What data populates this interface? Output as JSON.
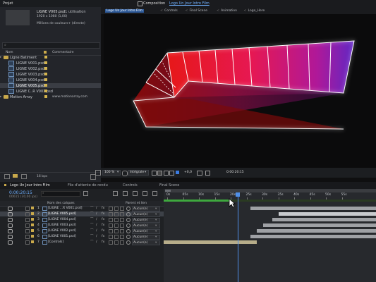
{
  "project": {
    "tab": "Projet",
    "file_name": "LIGNE V005.psd",
    "usage": ", 1 utilisation",
    "dimensions": "1920 x 1080 (1,00)",
    "colors": "Millions de couleurs+ (directe)",
    "col_name": "Nom",
    "col_comment": "Commentaire",
    "items": [
      {
        "label": "Ligne Batiment",
        "kind": "folder",
        "color": "#d4b44c"
      },
      {
        "label": "LIGNE V001.psd",
        "kind": "file",
        "color": "#d4b44c"
      },
      {
        "label": "LIGNE V002.psd",
        "kind": "file",
        "color": "#d4b44c"
      },
      {
        "label": "LIGNE V003.psd",
        "kind": "file",
        "color": "#d4b44c"
      },
      {
        "label": "LIGNE V004.psd",
        "kind": "file",
        "color": "#d4b44c"
      },
      {
        "label": "LIGNE V005.psd",
        "kind": "file",
        "color": "#d4b44c",
        "selected": true
      },
      {
        "label": "LIGNE C..R V001.psd",
        "kind": "file",
        "color": "#d4b44c"
      },
      {
        "label": "Motion Array",
        "kind": "folder",
        "color": "#d4b44c",
        "comment": "www.motionarray.com"
      }
    ],
    "bpc": "16 bpc"
  },
  "composition": {
    "header": "Composition",
    "comp_name": "Logo Un Jour Intro Film",
    "breadcrumbs": [
      "Logo Un Jour Intro Film",
      "Controls",
      "Final Scene",
      "Animation",
      "Logo_Here"
    ],
    "zoom": "100 %",
    "resolution": "Intégrale",
    "exposure": "+0,0",
    "timecode": "0:00:20:15"
  },
  "timeline": {
    "tabs": [
      "Logo Un Jour Intro Film",
      "File d'attente de rendu",
      "Controls",
      "Final Scene"
    ],
    "timecode": "0:00:20:15",
    "fps": "00615 (30,00 ips)",
    "col_layer": "Nom des calques",
    "col_parent": "Parent et lien",
    "layers": [
      {
        "num": "1",
        "name": "[LIGNE ...R V001.psd]",
        "parent": "Aucun(e)",
        "bar_start": 0.41,
        "bar_end": 1.0
      },
      {
        "num": "2",
        "name": "[LIGNE V005.psd]",
        "parent": "Aucun(e)",
        "bar_start": 0.54,
        "bar_end": 1.0,
        "selected": true
      },
      {
        "num": "3",
        "name": "[LIGNE V004.psd]",
        "parent": "Aucun(e)",
        "bar_start": 0.51,
        "bar_end": 1.0
      },
      {
        "num": "4",
        "name": "[LIGNE V003.psd]",
        "parent": "Aucun(e)",
        "bar_start": 0.47,
        "bar_end": 1.0
      },
      {
        "num": "5",
        "name": "[LIGNE V002.psd]",
        "parent": "Aucun(e)",
        "bar_start": 0.44,
        "bar_end": 1.0
      },
      {
        "num": "6",
        "name": "[LIGNE V001.psd]",
        "parent": "Aucun(e)",
        "bar_start": 0.41,
        "bar_end": 1.0
      },
      {
        "num": "7",
        "name": "[Controls]",
        "parent": "Aucun(e)",
        "bar_start": 0.0,
        "bar_end": 0.44
      }
    ],
    "ruler": [
      "0s",
      "05s",
      "10s",
      "15s",
      "20s",
      "25s",
      "30s",
      "35s",
      "40s",
      "45s",
      "50s",
      "55s"
    ],
    "playhead": 0.35
  }
}
